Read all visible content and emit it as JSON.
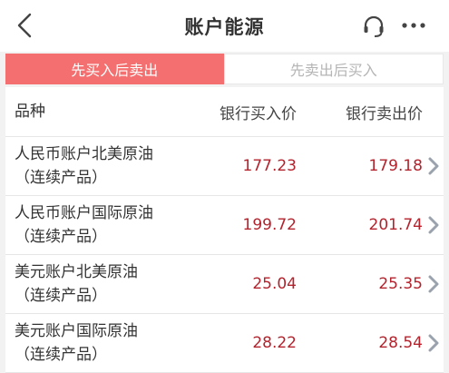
{
  "nav": {
    "title": "账户能源"
  },
  "tabs": [
    {
      "label": "先买入后卖出",
      "active": true
    },
    {
      "label": "先卖出后买入",
      "active": false
    }
  ],
  "table": {
    "headers": {
      "name": "品种",
      "buy": "银行买入价",
      "sell": "银行卖出价"
    },
    "rows": [
      {
        "name": "人民币账户北美原油",
        "sub": "（连续产品）",
        "buy": "177.23",
        "sell": "179.18"
      },
      {
        "name": "人民币账户国际原油",
        "sub": "（连续产品）",
        "buy": "199.72",
        "sell": "201.74"
      },
      {
        "name": "美元账户北美原油",
        "sub": "（连续产品）",
        "buy": "25.04",
        "sell": "25.35"
      },
      {
        "name": "美元账户国际原油",
        "sub": "（连续产品）",
        "buy": "28.22",
        "sell": "28.54"
      }
    ]
  },
  "colors": {
    "accent": "#f46f6f",
    "price": "#b3232d",
    "arrow": "#9aa3ad"
  },
  "icons": {
    "back": "chevron-left-icon",
    "service": "headset-icon",
    "more": "more-dots-icon",
    "row_arrow": "chevron-right-icon"
  }
}
